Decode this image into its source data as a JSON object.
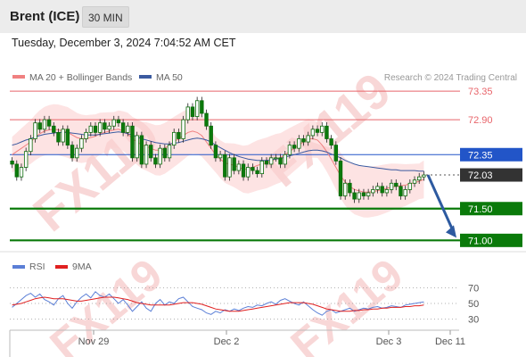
{
  "header": {
    "instrument": "Brent (ICE)",
    "timeframe": "30 MIN",
    "datetime": "Tuesday, December 3, 2024 7:04:52 AM CET"
  },
  "legend": {
    "ma20_label": "MA 20 + Bollinger Bands",
    "ma50_label": "MA 50",
    "ma20_color": "#f08080",
    "ma50_color": "#3b5aa0",
    "credit": "Research © 2024 Trading Central"
  },
  "rsi_legend": {
    "rsi_label": "RSI",
    "ma9_label": "9MA",
    "rsi_color": "#5b7fd6",
    "ma9_color": "#e02020"
  },
  "watermark": "FX119",
  "colors": {
    "candle_up": "#0b7a0b",
    "candle_down": "#0b7a0b",
    "resistance": "#e8646a",
    "pivot": "#2255c8",
    "support": "#0a7a0a",
    "current": "#333333",
    "arrow": "#2d5aa0",
    "band_fill": "#fbd0d0"
  },
  "chart_data": [
    {
      "type": "candlestick",
      "x_tick_labels": [
        "Nov 29",
        "Dec 2",
        "Dec 3",
        "Dec 11"
      ],
      "ylim": [
        70.85,
        73.45
      ],
      "levels": [
        {
          "value": 73.35,
          "label": "73.35",
          "kind": "resistance"
        },
        {
          "value": 72.9,
          "label": "72.90",
          "kind": "resistance"
        },
        {
          "value": 72.35,
          "label": "72.35",
          "kind": "pivot"
        },
        {
          "value": 72.03,
          "label": "72.03",
          "kind": "current"
        },
        {
          "value": 71.5,
          "label": "71.50",
          "kind": "support"
        },
        {
          "value": 71.0,
          "label": "71.00",
          "kind": "support"
        }
      ],
      "close": [
        72.2,
        72.0,
        72.15,
        72.4,
        72.6,
        72.85,
        72.75,
        72.9,
        72.8,
        72.7,
        72.55,
        72.75,
        72.5,
        72.3,
        72.45,
        72.6,
        72.7,
        72.8,
        72.7,
        72.85,
        72.75,
        72.8,
        72.9,
        72.85,
        72.7,
        72.8,
        72.3,
        72.65,
        72.2,
        72.5,
        72.3,
        72.2,
        72.45,
        72.3,
        72.5,
        72.7,
        72.6,
        72.9,
        73.1,
        72.95,
        73.2,
        73.0,
        72.8,
        72.5,
        72.3,
        72.35,
        72.0,
        72.3,
        72.1,
        72.2,
        72.0,
        72.15,
        72.1,
        72.05,
        72.25,
        72.2,
        72.3,
        72.3,
        72.2,
        72.35,
        72.5,
        72.45,
        72.6,
        72.55,
        72.65,
        72.75,
        72.7,
        72.8,
        72.6,
        72.5,
        72.25,
        71.7,
        71.9,
        71.75,
        71.65,
        71.75,
        71.7,
        71.75,
        71.8,
        71.85,
        71.75,
        71.8,
        71.9,
        71.85,
        71.7,
        71.8,
        71.9,
        71.95,
        72.0,
        72.03
      ],
      "ma20": [
        72.35,
        72.4,
        72.45,
        72.5,
        72.55,
        72.62,
        72.68,
        72.72,
        72.74,
        72.75,
        72.74,
        72.72,
        72.7,
        72.66,
        72.62,
        72.6,
        72.6,
        72.62,
        72.64,
        72.68,
        72.7,
        72.72,
        72.74,
        72.75,
        72.72,
        72.68,
        72.6,
        72.55,
        72.5,
        72.48,
        72.45,
        72.42,
        72.42,
        72.45,
        72.5,
        72.55,
        72.6,
        72.65,
        72.7,
        72.72,
        72.7,
        72.65,
        72.55,
        72.45,
        72.35,
        72.28,
        72.22,
        72.2,
        72.18,
        72.15,
        72.12,
        72.12,
        72.15,
        72.18,
        72.2,
        72.22,
        72.25,
        72.28,
        72.3,
        72.35,
        72.4,
        72.45,
        72.5,
        72.55,
        72.6,
        72.6,
        72.58,
        72.5,
        72.4,
        72.28,
        72.15,
        72.02,
        71.92,
        71.85,
        71.8,
        71.78,
        71.76,
        71.76,
        71.77,
        71.78,
        71.8,
        71.82,
        71.84,
        71.85,
        71.86,
        71.87,
        71.89,
        71.91,
        71.93,
        71.96
      ],
      "ma50": [
        72.5,
        72.52,
        72.55,
        72.58,
        72.6,
        72.63,
        72.65,
        72.67,
        72.68,
        72.69,
        72.7,
        72.7,
        72.7,
        72.69,
        72.68,
        72.67,
        72.66,
        72.66,
        72.66,
        72.67,
        72.68,
        72.69,
        72.7,
        72.71,
        72.7,
        72.68,
        72.66,
        72.63,
        72.6,
        72.58,
        72.56,
        72.54,
        72.53,
        72.52,
        72.52,
        72.53,
        72.54,
        72.56,
        72.58,
        72.6,
        72.61,
        72.6,
        72.58,
        72.55,
        72.5,
        72.46,
        72.42,
        72.38,
        72.35,
        72.32,
        72.3,
        72.28,
        72.27,
        72.26,
        72.26,
        72.26,
        72.27,
        72.28,
        72.29,
        72.31,
        72.33,
        72.35,
        72.37,
        72.39,
        72.41,
        72.42,
        72.42,
        72.41,
        72.39,
        72.36,
        72.33,
        72.3,
        72.26,
        72.23,
        72.2,
        72.18,
        72.17,
        72.16,
        72.15,
        72.14,
        72.13,
        72.12,
        72.11,
        72.11,
        72.1,
        72.1,
        72.1,
        72.1,
        72.09,
        72.09
      ],
      "forecast": {
        "from": 72.03,
        "to": 71.0
      }
    },
    {
      "type": "line",
      "title": "RSI",
      "yticks": [
        30,
        50,
        70
      ],
      "ylim": [
        25,
        75
      ],
      "series": [
        {
          "name": "RSI",
          "values": [
            45,
            50,
            55,
            60,
            63,
            58,
            62,
            55,
            52,
            48,
            56,
            60,
            50,
            44,
            52,
            58,
            62,
            57,
            65,
            60,
            58,
            62,
            56,
            50,
            55,
            48,
            40,
            46,
            52,
            44,
            40,
            50,
            55,
            48,
            52,
            50,
            56,
            58,
            52,
            46,
            44,
            42,
            38,
            36,
            40,
            38,
            42,
            40,
            43,
            41,
            44,
            46,
            45,
            48,
            47,
            50,
            52,
            49,
            54,
            56,
            53,
            50,
            48,
            52,
            47,
            42,
            38,
            35,
            40,
            42,
            38,
            40,
            42,
            44,
            40,
            42,
            44,
            43,
            45,
            46,
            44,
            45,
            47,
            46,
            45,
            48,
            49,
            50,
            51,
            52
          ]
        },
        {
          "name": "9MA",
          "values": [
            48,
            49,
            50,
            52,
            54,
            56,
            57,
            58,
            57,
            56,
            56,
            56,
            55,
            54,
            53,
            53,
            54,
            55,
            56,
            57,
            58,
            58,
            58,
            57,
            56,
            55,
            53,
            51,
            50,
            49,
            48,
            48,
            48,
            48,
            48,
            49,
            50,
            51,
            51,
            51,
            50,
            49,
            47,
            45,
            43,
            42,
            41,
            40,
            40,
            40,
            41,
            42,
            43,
            44,
            45,
            46,
            47,
            48,
            49,
            50,
            51,
            51,
            51,
            51,
            50,
            49,
            47,
            45,
            43,
            42,
            41,
            40,
            40,
            40,
            41,
            41,
            42,
            42,
            43,
            43,
            44,
            44,
            45,
            45,
            45,
            46,
            46,
            47,
            47,
            48
          ]
        }
      ]
    }
  ]
}
